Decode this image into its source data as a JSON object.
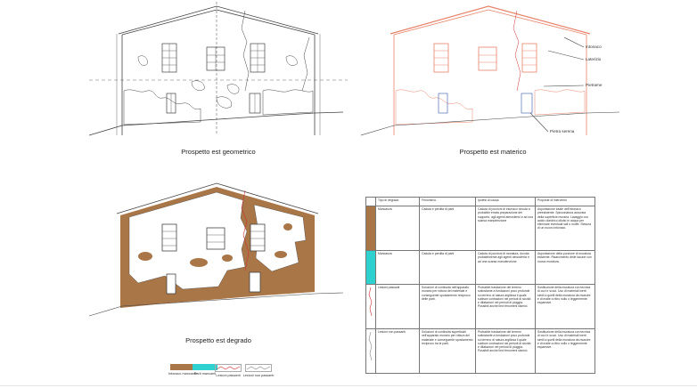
{
  "captions": {
    "geometric": "Prospetto est geometrico",
    "material": "Prospetto est materico",
    "decay": "Prospetto est degrado"
  },
  "material_labels": {
    "intonaco": "Intonaco",
    "laterizio": "Laterizio",
    "pietrame": "Pietrame",
    "pietra_serena": "Pietra serena"
  },
  "table": {
    "headers": [
      "Tipo di degrado",
      "Fenomeno",
      "Ipotesi di causa",
      "Proposte di intervento"
    ],
    "rows": [
      {
        "type": "Mancanza",
        "phenomenon": "Caduta e perdita di parti",
        "cause": "Caduta di porzioni di intonaco dovuta a probabile errata preparazione dei supporto, agli agenti atmosferici e ad una scarsa manutenzione",
        "intervention": "Asportazione totale dell'intonaco preesistente. Spicconatura accurata della superficie muraria. Lavaggio con acido cloridrico diluito in acqua per eliminare eventuali sali o muffe. Stesura di un nuovo intonaco."
      },
      {
        "type": "Mancanza",
        "phenomenon": "Caduta e perdita di parti",
        "cause": "Caduta di porzioni di muratura, dovuta probabilmente agli agenti atmosferici e ad una scarsa manutenzione.",
        "intervention": "Asportazione della porzione di muratura esistente. Risarcimento delle lacune con nuova muratura."
      },
      {
        "type": "Lesioni passanti",
        "phenomenon": "Soluzioni di continuità nell'apparato murario per rottura del materiale e conseguente spostamento reciproco delle parti.",
        "cause": "Probabile traslazione del terreno sottostante a fondazioni poco profonde su terreno di natura argillosa il quale subisce contrazioni nei periodi di siccità e dilatazioni nei periodi di pioggia. Possibili anche lievi fenomeni sismici.",
        "intervention": "Sostituzione della muratura con tecnica di cuci e scuci. Uso di materiali inerti simili a quelli della muratura da risarcire e di malte a ritiro nullo o leggermente espansive."
      },
      {
        "type": "Lesioni non passanti",
        "phenomenon": "Soluzioni di continuità superficiali nell'apparato murario per rottura del materiale e conseguente spostamento reciproco tra le parti.",
        "cause": "Probabile traslazione del terreno sottostante a fondazioni poco profonde su terreno di natura argillosa il quale subisce contrazioni nei periodi di siccità e dilatazioni nei periodi di pioggia. Possibili anche lievi fenomeni sismici.",
        "intervention": "Sostituzione della muratura con tecnica di cuci e scuci. Uso di materiali inerti simili a quelli della muratura da risarcire e di malte a ritiro nullo o leggermente espansive."
      }
    ]
  },
  "legend": [
    {
      "label": "Intonaco mancante",
      "color": "#a97647",
      "kind": "fill"
    },
    {
      "label": "Parti mancanti",
      "color": "#2fd1cf",
      "kind": "fill"
    },
    {
      "label": "Lesioni passanti",
      "color": "#cc3333",
      "kind": "crack"
    },
    {
      "label": "Lesioni non passanti",
      "color": "#888888",
      "kind": "crack"
    }
  ],
  "colors": {
    "intonaco_mancante": "#a97647",
    "parti_mancanti": "#2fd1cf",
    "material_line": "#e8836a",
    "line": "#444444"
  }
}
